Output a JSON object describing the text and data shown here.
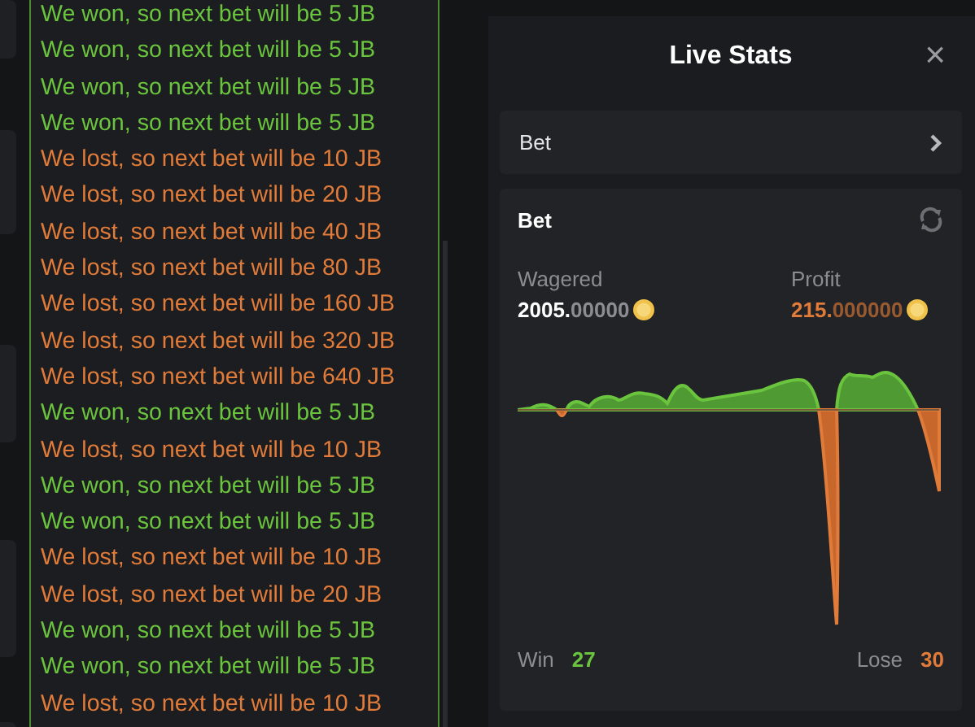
{
  "log": [
    {
      "kind": "won",
      "text": "We won, so next bet will be 5 JB"
    },
    {
      "kind": "won",
      "text": "We won, so next bet will be 5 JB"
    },
    {
      "kind": "won",
      "text": "We won, so next bet will be 5 JB"
    },
    {
      "kind": "won",
      "text": "We won, so next bet will be 5 JB"
    },
    {
      "kind": "lost",
      "text": "We lost, so next bet will be 10 JB"
    },
    {
      "kind": "lost",
      "text": "We lost, so next bet will be 20 JB"
    },
    {
      "kind": "lost",
      "text": "We lost, so next bet will be 40 JB"
    },
    {
      "kind": "lost",
      "text": "We lost, so next bet will be 80 JB"
    },
    {
      "kind": "lost",
      "text": "We lost, so next bet will be 160 JB"
    },
    {
      "kind": "lost",
      "text": "We lost, so next bet will be 320 JB"
    },
    {
      "kind": "lost",
      "text": "We lost, so next bet will be 640 JB"
    },
    {
      "kind": "won",
      "text": "We won, so next bet will be 5 JB"
    },
    {
      "kind": "lost",
      "text": "We lost, so next bet will be 10 JB"
    },
    {
      "kind": "won",
      "text": "We won, so next bet will be 5 JB"
    },
    {
      "kind": "won",
      "text": "We won, so next bet will be 5 JB"
    },
    {
      "kind": "lost",
      "text": "We lost, so next bet will be 10 JB"
    },
    {
      "kind": "lost",
      "text": "We lost, so next bet will be 20 JB"
    },
    {
      "kind": "won",
      "text": "We won, so next bet will be 5 JB"
    },
    {
      "kind": "won",
      "text": "We won, so next bet will be 5 JB"
    },
    {
      "kind": "lost",
      "text": "We lost, so next bet will be 10 JB"
    }
  ],
  "live_stats": {
    "title": "Live Stats",
    "close": "×",
    "bet_row": {
      "label": "Bet"
    },
    "card": {
      "title": "Bet",
      "wagered": {
        "label": "Wagered",
        "integer": "2005.",
        "decimals": "00000"
      },
      "profit": {
        "label": "Profit",
        "integer": "215.",
        "decimals": "000000"
      },
      "win": {
        "label": "Win",
        "value": "27"
      },
      "lose": {
        "label": "Lose",
        "value": "30"
      }
    }
  }
}
